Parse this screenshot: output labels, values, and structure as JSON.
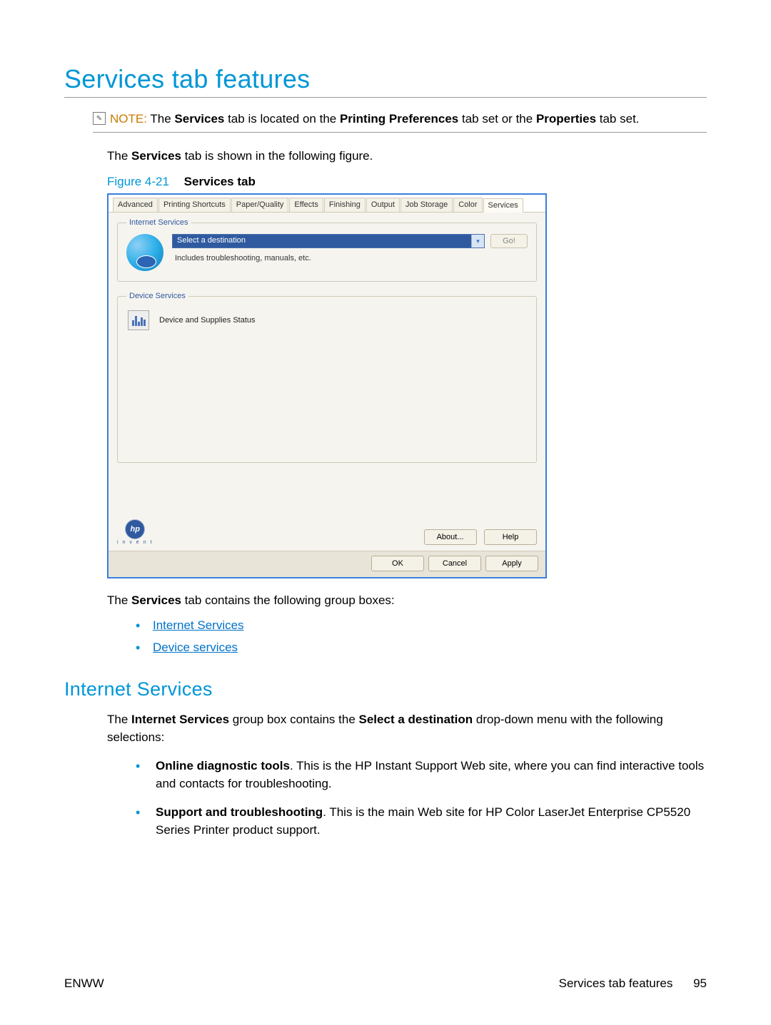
{
  "heading": "Services tab features",
  "note": {
    "prefix": "NOTE:",
    "text_before": "The ",
    "b1": "Services",
    "mid1": " tab is located on the ",
    "b2": "Printing Preferences",
    "mid2": " tab set or the ",
    "b3": "Properties",
    "after": " tab set."
  },
  "intro": {
    "pre": "The ",
    "b": "Services",
    "post": " tab is shown in the following figure."
  },
  "caption": {
    "prefix": "Figure 4-21",
    "text": "Services  tab"
  },
  "dialog": {
    "tabs": [
      "Advanced",
      "Printing Shortcuts",
      "Paper/Quality",
      "Effects",
      "Finishing",
      "Output",
      "Job Storage",
      "Color",
      "Services"
    ],
    "active_tab_index": 8,
    "internet_group": "Internet Services",
    "dest_placeholder": "Select a destination",
    "go": "Go!",
    "includes": "Includes troubleshooting, manuals, etc.",
    "device_group": "Device Services",
    "device_status": "Device and Supplies Status",
    "invent": "i n v e n t",
    "about": "About...",
    "help": "Help",
    "ok": "OK",
    "cancel": "Cancel",
    "apply": "Apply"
  },
  "after_fig": {
    "pre": "The ",
    "b": "Services",
    "post": " tab contains the following group boxes:"
  },
  "links": {
    "internet": "Internet Services",
    "device": "Device services"
  },
  "sub_heading": "Internet Services",
  "is_para": {
    "pre": "The ",
    "b1": "Internet Services",
    "mid": " group box contains the ",
    "b2": "Select a destination",
    "post": " drop-down menu with the following selections:"
  },
  "bullets": {
    "b1_bold": "Online diagnostic tools",
    "b1_text": ". This is the HP Instant Support Web site, where you can find interactive tools and contacts for troubleshooting.",
    "b2_bold": "Support and troubleshooting",
    "b2_text": ". This is the main Web site for HP Color LaserJet Enterprise CP5520 Series Printer product support."
  },
  "footer": {
    "left": "ENWW",
    "right_label": "Services tab features",
    "page": "95"
  }
}
